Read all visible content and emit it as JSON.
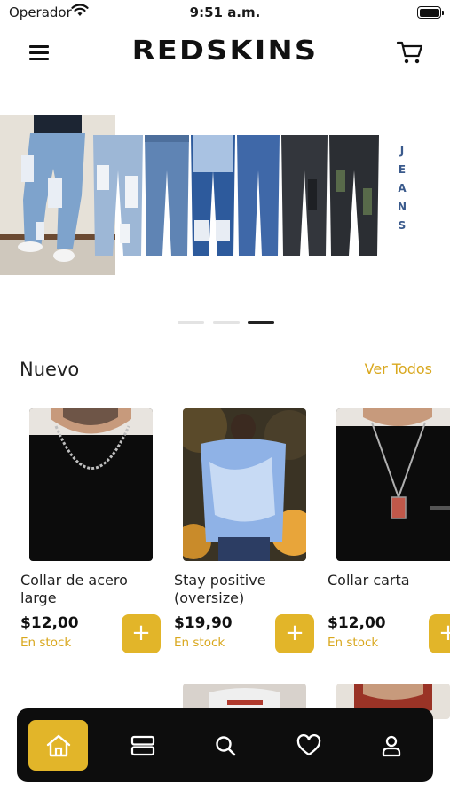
{
  "status_bar": {
    "carrier": "Operador",
    "time": "9:51 a.m."
  },
  "header": {
    "brand": "REDSKINS",
    "menu_icon": "hamburger-menu-icon",
    "cart_icon": "shopping-cart-icon"
  },
  "banner": {
    "side_text": [
      "J",
      "E",
      "A",
      "N",
      "S"
    ],
    "pages": 3,
    "active_page": 3
  },
  "section": {
    "title": "Nuevo",
    "see_all": "Ver Todos"
  },
  "products": [
    {
      "name": "Collar de acero large",
      "price": "$12,00",
      "stock": "En stock",
      "add_label": "+"
    },
    {
      "name": "Stay positive (oversize)",
      "price": "$19,90",
      "stock": "En stock",
      "add_label": "+"
    },
    {
      "name": "Collar carta",
      "price": "$12,00",
      "stock": "En stock",
      "add_label": "+"
    }
  ],
  "bottom_nav": {
    "items": [
      "home-icon",
      "catalog-icon",
      "search-icon",
      "favorites-icon",
      "profile-icon"
    ],
    "active": "home-icon"
  },
  "colors": {
    "accent": "#e2b529",
    "accent_text": "#d9a81f",
    "nav_bg": "#0d0d0d"
  }
}
